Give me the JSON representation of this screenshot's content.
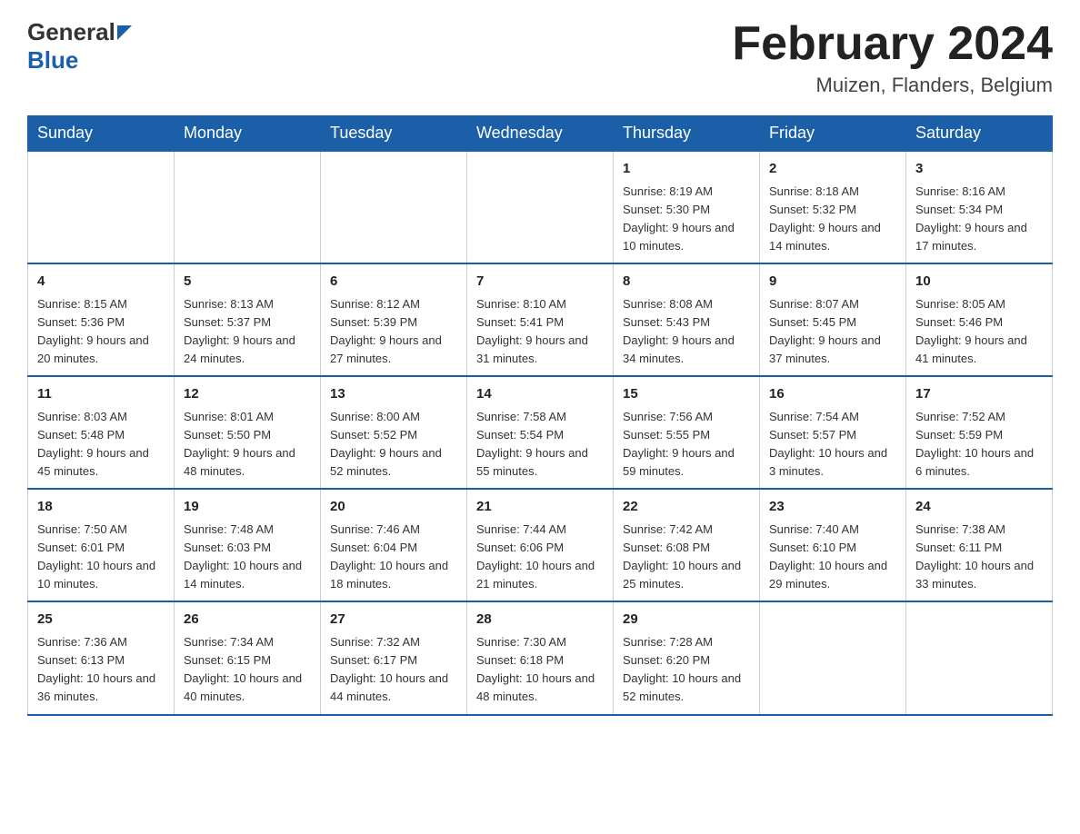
{
  "header": {
    "logo_general": "General",
    "logo_blue": "Blue",
    "month_title": "February 2024",
    "location": "Muizen, Flanders, Belgium"
  },
  "days_of_week": [
    "Sunday",
    "Monday",
    "Tuesday",
    "Wednesday",
    "Thursday",
    "Friday",
    "Saturday"
  ],
  "weeks": [
    [
      {
        "day": "",
        "sunrise": "",
        "sunset": "",
        "daylight": ""
      },
      {
        "day": "",
        "sunrise": "",
        "sunset": "",
        "daylight": ""
      },
      {
        "day": "",
        "sunrise": "",
        "sunset": "",
        "daylight": ""
      },
      {
        "day": "",
        "sunrise": "",
        "sunset": "",
        "daylight": ""
      },
      {
        "day": "1",
        "sunrise": "Sunrise: 8:19 AM",
        "sunset": "Sunset: 5:30 PM",
        "daylight": "Daylight: 9 hours and 10 minutes."
      },
      {
        "day": "2",
        "sunrise": "Sunrise: 8:18 AM",
        "sunset": "Sunset: 5:32 PM",
        "daylight": "Daylight: 9 hours and 14 minutes."
      },
      {
        "day": "3",
        "sunrise": "Sunrise: 8:16 AM",
        "sunset": "Sunset: 5:34 PM",
        "daylight": "Daylight: 9 hours and 17 minutes."
      }
    ],
    [
      {
        "day": "4",
        "sunrise": "Sunrise: 8:15 AM",
        "sunset": "Sunset: 5:36 PM",
        "daylight": "Daylight: 9 hours and 20 minutes."
      },
      {
        "day": "5",
        "sunrise": "Sunrise: 8:13 AM",
        "sunset": "Sunset: 5:37 PM",
        "daylight": "Daylight: 9 hours and 24 minutes."
      },
      {
        "day": "6",
        "sunrise": "Sunrise: 8:12 AM",
        "sunset": "Sunset: 5:39 PM",
        "daylight": "Daylight: 9 hours and 27 minutes."
      },
      {
        "day": "7",
        "sunrise": "Sunrise: 8:10 AM",
        "sunset": "Sunset: 5:41 PM",
        "daylight": "Daylight: 9 hours and 31 minutes."
      },
      {
        "day": "8",
        "sunrise": "Sunrise: 8:08 AM",
        "sunset": "Sunset: 5:43 PM",
        "daylight": "Daylight: 9 hours and 34 minutes."
      },
      {
        "day": "9",
        "sunrise": "Sunrise: 8:07 AM",
        "sunset": "Sunset: 5:45 PM",
        "daylight": "Daylight: 9 hours and 37 minutes."
      },
      {
        "day": "10",
        "sunrise": "Sunrise: 8:05 AM",
        "sunset": "Sunset: 5:46 PM",
        "daylight": "Daylight: 9 hours and 41 minutes."
      }
    ],
    [
      {
        "day": "11",
        "sunrise": "Sunrise: 8:03 AM",
        "sunset": "Sunset: 5:48 PM",
        "daylight": "Daylight: 9 hours and 45 minutes."
      },
      {
        "day": "12",
        "sunrise": "Sunrise: 8:01 AM",
        "sunset": "Sunset: 5:50 PM",
        "daylight": "Daylight: 9 hours and 48 minutes."
      },
      {
        "day": "13",
        "sunrise": "Sunrise: 8:00 AM",
        "sunset": "Sunset: 5:52 PM",
        "daylight": "Daylight: 9 hours and 52 minutes."
      },
      {
        "day": "14",
        "sunrise": "Sunrise: 7:58 AM",
        "sunset": "Sunset: 5:54 PM",
        "daylight": "Daylight: 9 hours and 55 minutes."
      },
      {
        "day": "15",
        "sunrise": "Sunrise: 7:56 AM",
        "sunset": "Sunset: 5:55 PM",
        "daylight": "Daylight: 9 hours and 59 minutes."
      },
      {
        "day": "16",
        "sunrise": "Sunrise: 7:54 AM",
        "sunset": "Sunset: 5:57 PM",
        "daylight": "Daylight: 10 hours and 3 minutes."
      },
      {
        "day": "17",
        "sunrise": "Sunrise: 7:52 AM",
        "sunset": "Sunset: 5:59 PM",
        "daylight": "Daylight: 10 hours and 6 minutes."
      }
    ],
    [
      {
        "day": "18",
        "sunrise": "Sunrise: 7:50 AM",
        "sunset": "Sunset: 6:01 PM",
        "daylight": "Daylight: 10 hours and 10 minutes."
      },
      {
        "day": "19",
        "sunrise": "Sunrise: 7:48 AM",
        "sunset": "Sunset: 6:03 PM",
        "daylight": "Daylight: 10 hours and 14 minutes."
      },
      {
        "day": "20",
        "sunrise": "Sunrise: 7:46 AM",
        "sunset": "Sunset: 6:04 PM",
        "daylight": "Daylight: 10 hours and 18 minutes."
      },
      {
        "day": "21",
        "sunrise": "Sunrise: 7:44 AM",
        "sunset": "Sunset: 6:06 PM",
        "daylight": "Daylight: 10 hours and 21 minutes."
      },
      {
        "day": "22",
        "sunrise": "Sunrise: 7:42 AM",
        "sunset": "Sunset: 6:08 PM",
        "daylight": "Daylight: 10 hours and 25 minutes."
      },
      {
        "day": "23",
        "sunrise": "Sunrise: 7:40 AM",
        "sunset": "Sunset: 6:10 PM",
        "daylight": "Daylight: 10 hours and 29 minutes."
      },
      {
        "day": "24",
        "sunrise": "Sunrise: 7:38 AM",
        "sunset": "Sunset: 6:11 PM",
        "daylight": "Daylight: 10 hours and 33 minutes."
      }
    ],
    [
      {
        "day": "25",
        "sunrise": "Sunrise: 7:36 AM",
        "sunset": "Sunset: 6:13 PM",
        "daylight": "Daylight: 10 hours and 36 minutes."
      },
      {
        "day": "26",
        "sunrise": "Sunrise: 7:34 AM",
        "sunset": "Sunset: 6:15 PM",
        "daylight": "Daylight: 10 hours and 40 minutes."
      },
      {
        "day": "27",
        "sunrise": "Sunrise: 7:32 AM",
        "sunset": "Sunset: 6:17 PM",
        "daylight": "Daylight: 10 hours and 44 minutes."
      },
      {
        "day": "28",
        "sunrise": "Sunrise: 7:30 AM",
        "sunset": "Sunset: 6:18 PM",
        "daylight": "Daylight: 10 hours and 48 minutes."
      },
      {
        "day": "29",
        "sunrise": "Sunrise: 7:28 AM",
        "sunset": "Sunset: 6:20 PM",
        "daylight": "Daylight: 10 hours and 52 minutes."
      },
      {
        "day": "",
        "sunrise": "",
        "sunset": "",
        "daylight": ""
      },
      {
        "day": "",
        "sunrise": "",
        "sunset": "",
        "daylight": ""
      }
    ]
  ]
}
